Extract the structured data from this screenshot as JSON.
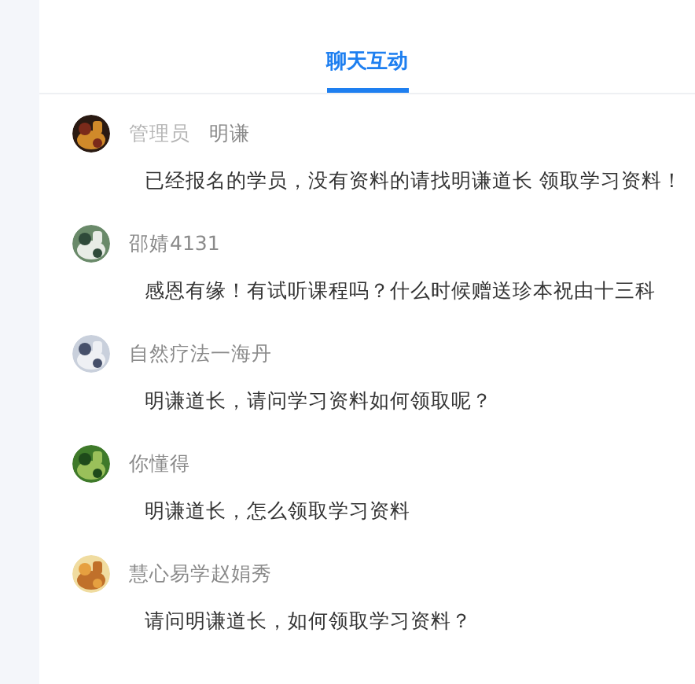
{
  "tabs": [
    {
      "label": "聊天互动",
      "selected": true
    }
  ],
  "messages": [
    {
      "role": "管理员",
      "name": "明谦",
      "text": "已经报名的学员，没有资料的请找明谦道长 领取学习资料！"
    },
    {
      "name": "邵婧4131",
      "text": "感恩有缘！有试听课程吗？什么时候赠送珍本祝由十三科"
    },
    {
      "name": "自然疗法一海丹",
      "text": "明谦道长，请问学习资料如何领取呢？"
    },
    {
      "name": "你懂得",
      "text": "明谦道长，怎么领取学习资料"
    },
    {
      "name": "慧心易学赵娟秀",
      "text": "请问明谦道长，如何领取学习资料？"
    }
  ]
}
